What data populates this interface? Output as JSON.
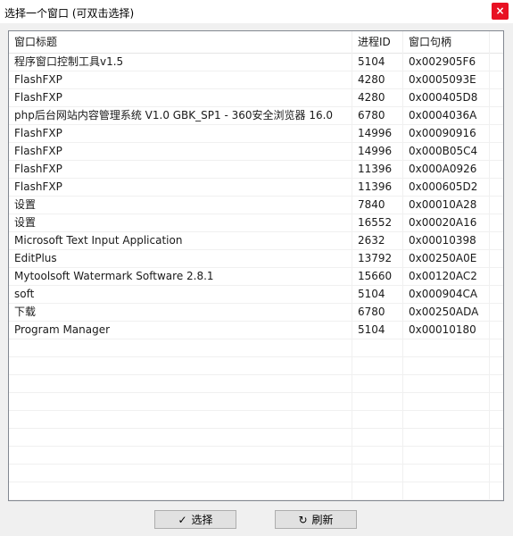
{
  "window": {
    "title": "选择一个窗口 (可双击选择)",
    "close_glyph": "×",
    "close_color": "#e81123"
  },
  "list": {
    "columns": [
      "窗口标题",
      "进程ID",
      "窗口句柄"
    ],
    "rows": [
      {
        "title": "程序窗口控制工具v1.5",
        "pid": "5104",
        "handle": "0x002905F6"
      },
      {
        "title": "FlashFXP",
        "pid": "4280",
        "handle": "0x0005093E"
      },
      {
        "title": "FlashFXP",
        "pid": "4280",
        "handle": "0x000405D8"
      },
      {
        "title": "php后台网站内容管理系统 V1.0 GBK_SP1 - 360安全浏览器 16.0",
        "pid": "6780",
        "handle": "0x0004036A"
      },
      {
        "title": "FlashFXP",
        "pid": "14996",
        "handle": "0x00090916"
      },
      {
        "title": "FlashFXP",
        "pid": "14996",
        "handle": "0x000B05C4"
      },
      {
        "title": "FlashFXP",
        "pid": "11396",
        "handle": "0x000A0926"
      },
      {
        "title": "FlashFXP",
        "pid": "11396",
        "handle": "0x000605D2"
      },
      {
        "title": "设置",
        "pid": "7840",
        "handle": "0x00010A28"
      },
      {
        "title": "设置",
        "pid": "16552",
        "handle": "0x00020A16"
      },
      {
        "title": "Microsoft Text Input Application",
        "pid": "2632",
        "handle": "0x00010398"
      },
      {
        "title": "EditPlus",
        "pid": "13792",
        "handle": "0x00250A0E"
      },
      {
        "title": "Mytoolsoft Watermark Software 2.8.1",
        "pid": "15660",
        "handle": "0x00120AC2"
      },
      {
        "title": "soft",
        "pid": "5104",
        "handle": "0x000904CA"
      },
      {
        "title": "下载",
        "pid": "6780",
        "handle": "0x00250ADA"
      },
      {
        "title": "Program Manager",
        "pid": "5104",
        "handle": "0x00010180"
      }
    ],
    "empty_rows": 9
  },
  "buttons": {
    "select": {
      "label": "选择",
      "icon": "check-icon",
      "glyph": "✓"
    },
    "refresh": {
      "label": "刷新",
      "icon": "refresh-icon",
      "glyph": "↻"
    }
  }
}
